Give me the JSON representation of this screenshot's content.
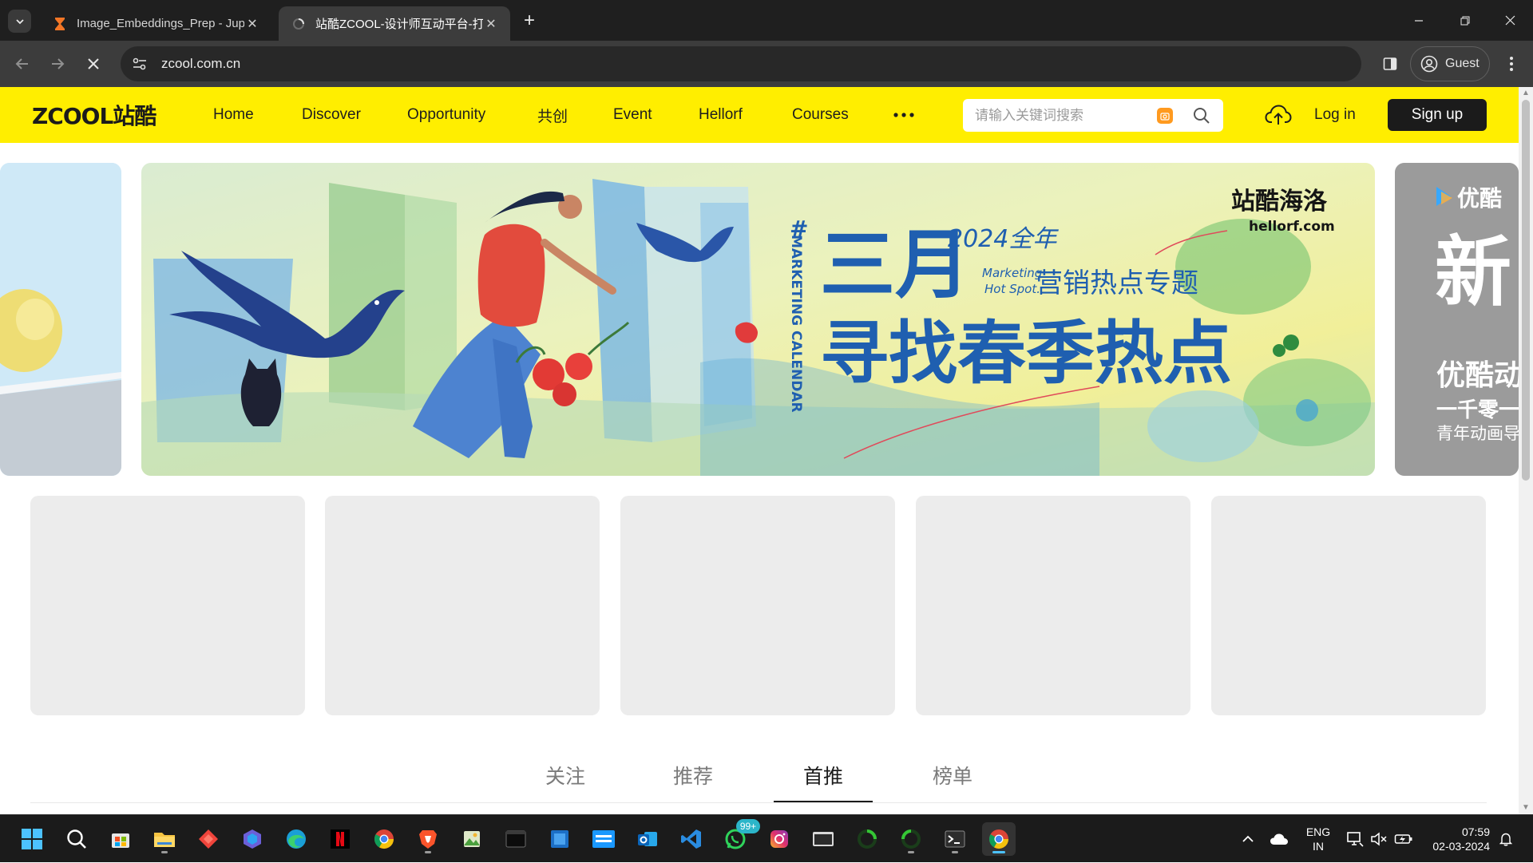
{
  "browser": {
    "tabs": [
      {
        "title": "Image_Embeddings_Prep - Jupy",
        "active": false
      },
      {
        "title": "站酷ZCOOL-设计师互动平台-打",
        "active": true
      }
    ],
    "url": "zcool.com.cn",
    "profile_label": "Guest"
  },
  "site": {
    "logo": "ZCOOL站酷",
    "nav": [
      "Home",
      "Discover",
      "Opportunity",
      "共创",
      "Event",
      "Hellorf",
      "Courses"
    ],
    "search_placeholder": "请输入关键词搜索",
    "login_label": "Log in",
    "signup_label": "Sign up",
    "accent_color": "#ffee00"
  },
  "banner": {
    "brand": "站酷海洛",
    "brand_url": "hellorf.com",
    "hash": "#",
    "vertical_text": "MARKETING CALENDAR",
    "year_text": "2024全年",
    "marketing_en": "Marketing",
    "hotspot_en": "Hot Spot.",
    "subtitle": "营销热点专题",
    "month_text": "三月",
    "headline": "寻找春季热点",
    "right_brand": "优酷",
    "right_big": "新",
    "right_line1": "优酷动",
    "right_line2": "一千零一",
    "right_line3": "青年动画导"
  },
  "feed_tabs": [
    {
      "label": "关注",
      "active": false
    },
    {
      "label": "推荐",
      "active": false
    },
    {
      "label": "首推",
      "active": true
    },
    {
      "label": "榜单",
      "active": false
    }
  ],
  "taskbar": {
    "apps": [
      "start-icon",
      "search-icon",
      "store-icon",
      "file-explorer-icon",
      "anydesk-icon",
      "copilot-icon",
      "edge-icon",
      "netflix-icon",
      "chrome-icon",
      "brave-icon",
      "photos-icon",
      "terminal-icon",
      "windows-sandbox-icon",
      "prime-video-icon",
      "outlook-icon",
      "vscode-icon",
      "whatsapp-icon",
      "instagram-icon",
      "virtual-machine-icon",
      "loading-app-icon",
      "loading-app-2-icon",
      "console-icon",
      "chrome-active-icon"
    ],
    "whatsapp_badge": "99+",
    "language_line1": "ENG",
    "language_line2": "IN",
    "time": "07:59",
    "date": "02-03-2024"
  }
}
